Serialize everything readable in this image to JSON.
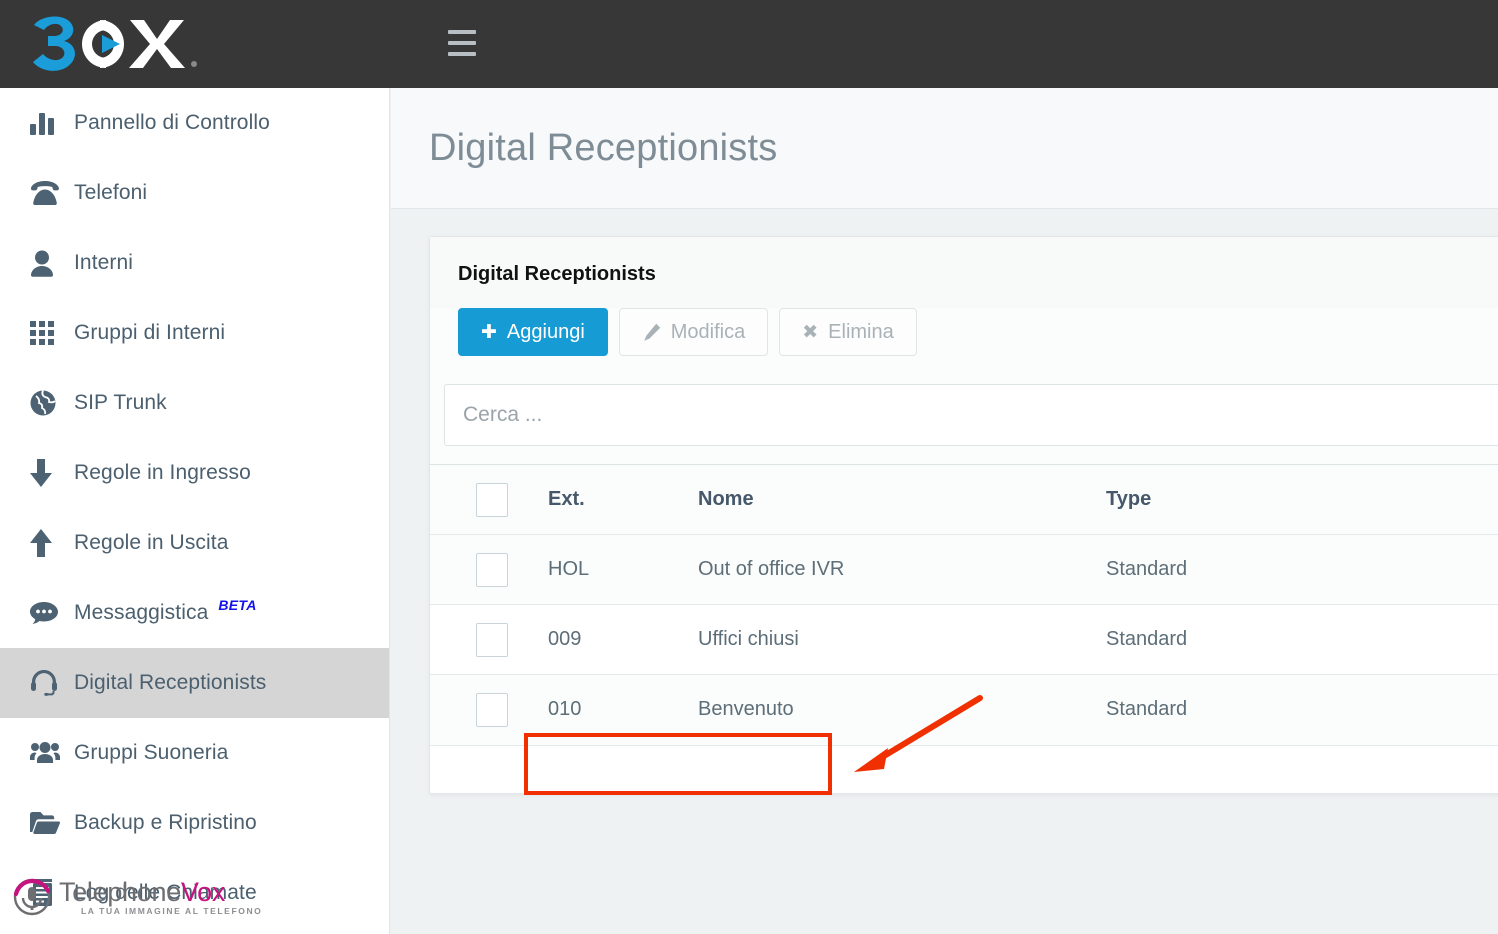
{
  "brand": {
    "logo_text": "3CX",
    "accent_color": "#1a9dd9",
    "header_bg": "#373737"
  },
  "topbar": {
    "menu_toggle": "hamburger-menu"
  },
  "sidebar": {
    "items": [
      {
        "label": "Pannello di Controllo",
        "icon": "bar-chart-icon",
        "active": false
      },
      {
        "label": "Telefoni",
        "icon": "telephone-icon",
        "active": false
      },
      {
        "label": "Interni",
        "icon": "user-icon",
        "active": false
      },
      {
        "label": "Gruppi di Interni",
        "icon": "grid-icon",
        "active": false
      },
      {
        "label": "SIP Trunk",
        "icon": "globe-icon",
        "active": false
      },
      {
        "label": "Regole in Ingresso",
        "icon": "arrow-down-icon",
        "active": false
      },
      {
        "label": "Regole in Uscita",
        "icon": "arrow-up-icon",
        "active": false
      },
      {
        "label": "Messaggistica",
        "icon": "chat-bubble-icon",
        "badge": "BETA",
        "active": false
      },
      {
        "label": "Digital Receptionists",
        "icon": "headset-icon",
        "active": true
      },
      {
        "label": "Gruppi Suoneria",
        "icon": "users-group-icon",
        "active": false
      },
      {
        "label": "Backup e Ripristino",
        "icon": "folder-icon",
        "active": false
      },
      {
        "label": "Log delle Chiamate",
        "icon": "call-log-icon",
        "active": false
      }
    ]
  },
  "watermark": {
    "name_gray": "Telephone",
    "name_pink": "Vox",
    "tagline": "LA TUA IMMAGINE AL TELEFONO",
    "pink": "#c6137f"
  },
  "main": {
    "page_title": "Digital Receptionists",
    "panel_title": "Digital Receptionists",
    "toolbar": {
      "add_label": "Aggiungi",
      "edit_label": "Modifica",
      "delete_label": "Elimina"
    },
    "search": {
      "value": "",
      "placeholder": "Cerca ..."
    },
    "table": {
      "headers": [
        "",
        "Ext.",
        "Nome",
        "Type"
      ],
      "rows": [
        {
          "ext": "HOL",
          "nome": "Out of office IVR",
          "type": "Standard",
          "checked": false
        },
        {
          "ext": "009",
          "nome": "Uffici chiusi",
          "type": "Standard",
          "checked": false
        },
        {
          "ext": "010",
          "nome": "Benvenuto",
          "type": "Standard",
          "checked": false
        }
      ]
    }
  },
  "annotations": {
    "highlight_color": "#f03000",
    "highlight_target": "010 Benvenuto",
    "arrow": "points to highlighted row"
  }
}
